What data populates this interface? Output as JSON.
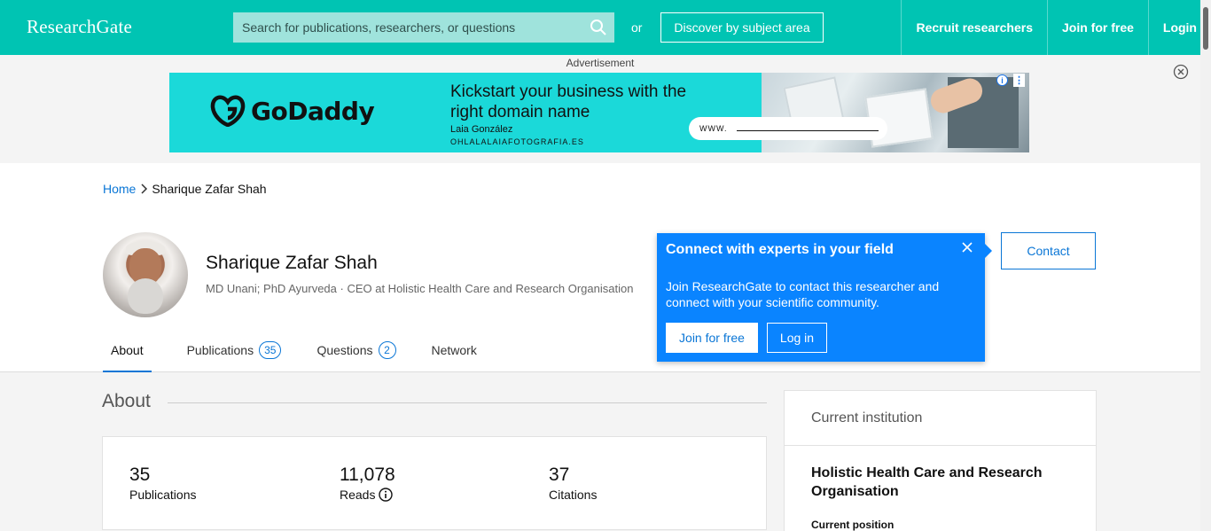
{
  "header": {
    "logo": "ResearchGate",
    "search_placeholder": "Search for publications, researchers, or questions",
    "or": "or",
    "discover": "Discover by subject area",
    "nav": [
      "Recruit researchers",
      "Join for free",
      "Login"
    ],
    "brand_color": "#00c4b3"
  },
  "ad": {
    "label": "Advertisement",
    "brand": "GoDaddy",
    "headline": "Kickstart your business with the right domain name",
    "person": "Laia González",
    "domain": "OHLALALAIAFOTOGRAFIA.ES",
    "www": "WWW."
  },
  "breadcrumb": {
    "home": "Home",
    "current": "Sharique Zafar Shah"
  },
  "profile": {
    "name": "Sharique Zafar Shah",
    "subtitle": "MD Unani; PhD Ayurveda · CEO at Holistic Health Care and Research Organisation",
    "contact": "Contact"
  },
  "tabs": [
    {
      "label": "About",
      "count": null
    },
    {
      "label": "Publications",
      "count": "35"
    },
    {
      "label": "Questions",
      "count": "2"
    },
    {
      "label": "Network",
      "count": null
    }
  ],
  "popup": {
    "title": "Connect with experts in your field",
    "body": "Join ResearchGate to contact this researcher and connect with your scientific community.",
    "join": "Join for free",
    "login": "Log in"
  },
  "about": {
    "heading": "About",
    "stats": [
      {
        "value": "35",
        "label": "Publications"
      },
      {
        "value": "11,078",
        "label": "Reads"
      },
      {
        "value": "37",
        "label": "Citations"
      }
    ]
  },
  "institution": {
    "heading": "Current institution",
    "name": "Holistic Health Care and Research Organisation",
    "position_label": "Current position"
  }
}
